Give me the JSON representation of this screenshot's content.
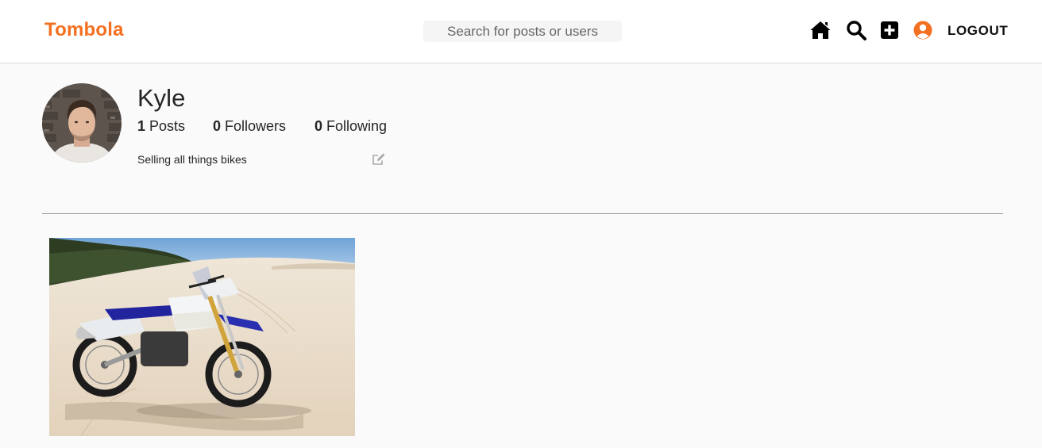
{
  "navbar": {
    "brand": "Tombola",
    "search_placeholder": "Search for posts or users",
    "icons": [
      "home-icon",
      "search-icon",
      "plus-square-icon",
      "user-circle-icon"
    ],
    "logout_label": "LOGOUT",
    "accent_color": "#f37021"
  },
  "profile": {
    "username": "Kyle",
    "posts_count": "1",
    "posts_label": "Posts",
    "followers_count": "0",
    "followers_label": "Followers",
    "following_count": "0",
    "following_label": "Following",
    "bio": "Selling all things bikes",
    "avatar_icon": "avatar-photo",
    "edit_icon": "edit-icon"
  },
  "posts": [
    {
      "image": "dirt-bike-on-sand-dunes-photo"
    }
  ]
}
